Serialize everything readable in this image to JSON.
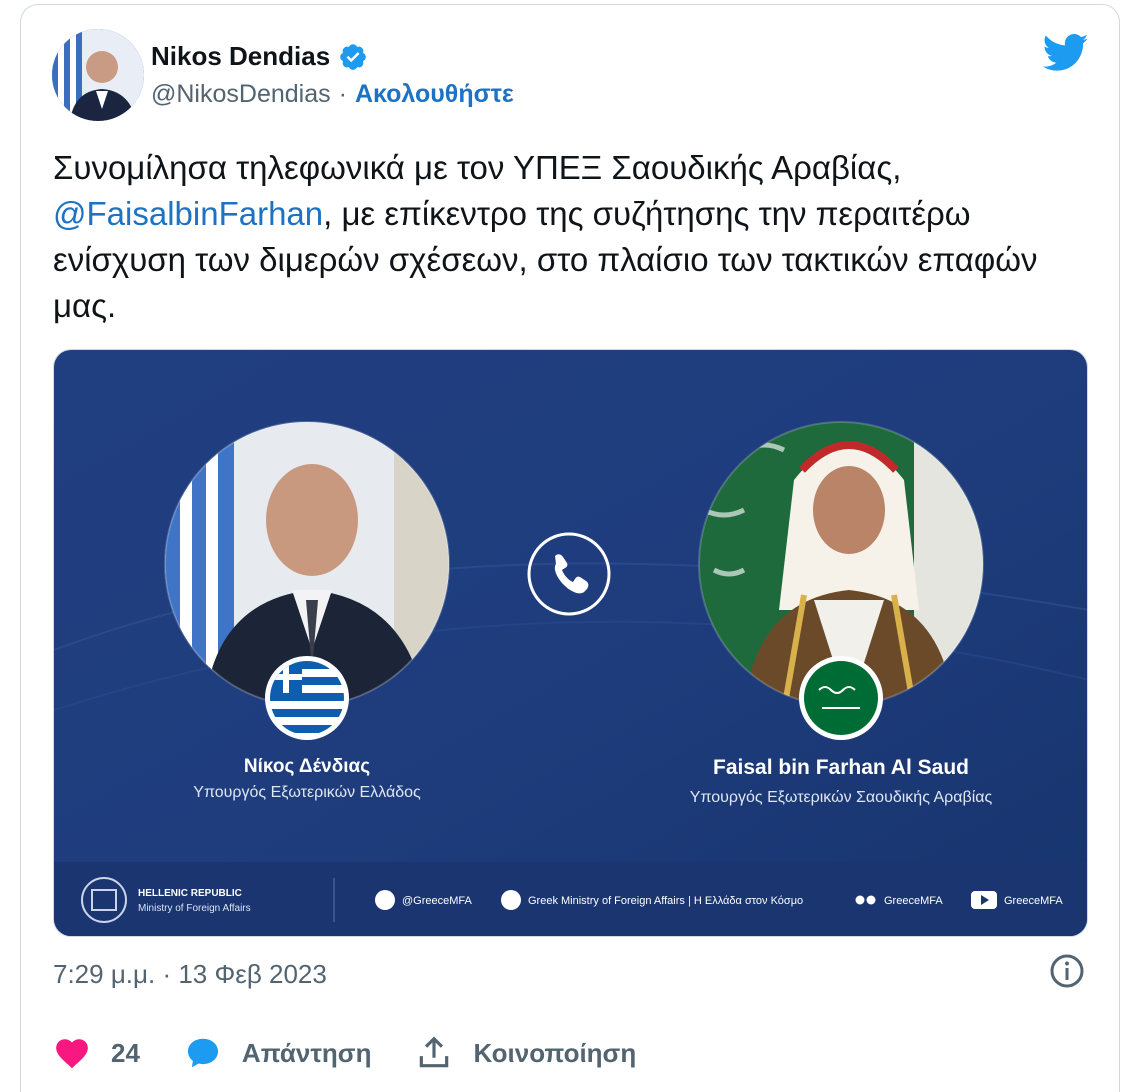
{
  "author": {
    "name": "Nikos Dendias",
    "handle": "@NikosDendias",
    "separator": "·",
    "follow_label": "Ακολουθήστε"
  },
  "tweet": {
    "text_before": "Συνομίλησα τηλεφωνικά με τον ΥΠΕΞ Σαουδικής Αραβίας,",
    "mention": "@FaisalbinFarhan",
    "text_after": ", με επίκεντρο της συζήτησης την περαιτέρω ενίσχυση των διμερών σχέσεων, στο πλαίσιο των τακτικών επαφών μας."
  },
  "media": {
    "left_person_name": "Νίκος Δένδιας",
    "left_person_title": "Υπουργός Εξωτερικών Ελλάδος",
    "right_person_name": "Faisal bin Farhan Al Saud",
    "right_person_title": "Υπουργός Εξωτερικών Σαουδικής Αραβίας",
    "org_line1": "HELLENIC REPUBLIC",
    "org_line2": "Ministry of Foreign Affairs",
    "social_twitter": "@GreeceMFA",
    "social_facebook": "Greek Ministry of Foreign Affairs | Η Ελλάδα στον Κόσμο",
    "social_flickr": "GreeceMFA",
    "social_youtube": "GreeceMFA"
  },
  "timestamp": "7:29 μ.μ. · 13 Φεβ 2023",
  "actions": {
    "like_count": "24",
    "reply_label": "Απάντηση",
    "share_label": "Κοινοποίηση"
  },
  "colors": {
    "brand_blue": "#1d9bf0",
    "link_blue": "#1d72c4",
    "like_pink": "#f91880",
    "media_bg": "#1d3f7e"
  }
}
